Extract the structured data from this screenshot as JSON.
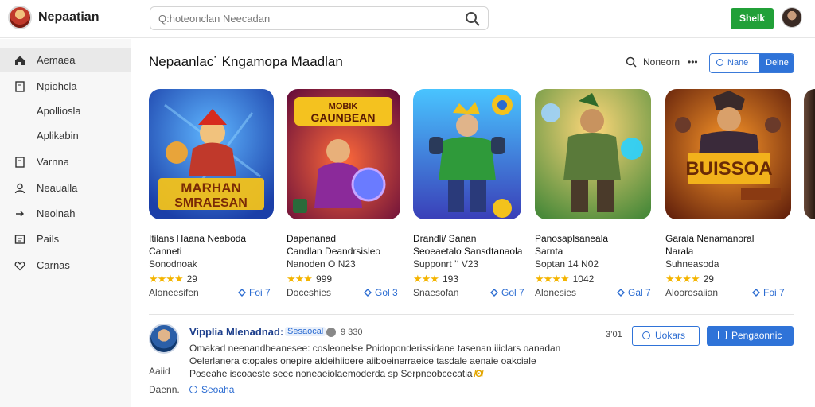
{
  "header": {
    "brand_name": "Nepaatian",
    "search_placeholder": "Q:hoteonclan Neecadan",
    "signin_label": "Shelk"
  },
  "sidebar": {
    "items": [
      {
        "label": "Aemaea",
        "icon": "home-icon"
      },
      {
        "label": "Npiohcla",
        "icon": "bookmark-icon"
      },
      {
        "label": "Apolliosla",
        "icon": ""
      },
      {
        "label": "Aplikabin",
        "icon": ""
      },
      {
        "label": "Varnna",
        "icon": "bookmark-icon"
      },
      {
        "label": "Neaualla",
        "icon": "user-icon"
      },
      {
        "label": "Neolnah",
        "icon": "share-icon"
      },
      {
        "label": "Pails",
        "icon": "image-icon"
      },
      {
        "label": "Carnas",
        "icon": "heart-icon"
      }
    ]
  },
  "main": {
    "title": "Nepaanlac˙  Kngamopa Maadlan",
    "filter_label": "Noneorn",
    "filter_dots": "•••",
    "seg_a": "Nane",
    "seg_b": "Deine"
  },
  "cards": [
    {
      "title": "Itilans Haana Neaboda\nCanneti",
      "developer": "Sonodnoak",
      "rating": "29",
      "stars": "★★★★",
      "tag": "Aloneesifen",
      "link": "Foi 7"
    },
    {
      "title": "Dapenanad\nCandlan Deandrsisleo",
      "developer": "Nanoden O N23",
      "rating": "999",
      "stars": "★★★",
      "tag": "Doceshies",
      "link": "Gol 3"
    },
    {
      "title": "Drandli/ Sanan\nSeoeaetalo Sansdtanaola",
      "developer": "Supponrt ’‘ V23",
      "rating": "193",
      "stars": "★★★",
      "tag": "Snaesofan",
      "link": "Gol 7"
    },
    {
      "title": "Panosaplsaneala\nSarnta",
      "developer": "Soptan 14 N02",
      "rating": "1042",
      "stars": "★★★★",
      "tag": "Alonesies",
      "link": "Gal 7"
    },
    {
      "title": "Garala Nenamanoral\nNarala",
      "developer": "Suhneasoda",
      "rating": "29",
      "stars": "★★★★",
      "tag": "Aloorosaiian",
      "link": "Foi 7"
    }
  ],
  "review": {
    "name": "Vipplia Mlenadnad:",
    "badge": "Sesaocal",
    "meta": "9 330",
    "lines": [
      "Omakad neenandbeanesee: cosleonelse Pnidoponderissidane tasenan iiiclars oanadan",
      "Oelerlanera ctopales onepire aldeihiioere aiiboeinerraeice tasdale aenaie oakciale",
      "Poseahe iscoaeste seec noneaeiolaemoderda sp Serpneobcecatia"
    ],
    "gold_text": "̸ʘ̸",
    "count": "3’01",
    "outline_btn": "Uokars",
    "fill_btn": "Pengaonnic",
    "side_note_1": "Aaiid",
    "side_note_2": "Daenn.",
    "link": "Seoaha"
  },
  "colors": {
    "accent_blue": "#2f73d8",
    "green": "#21a038",
    "star": "#f4b400"
  }
}
